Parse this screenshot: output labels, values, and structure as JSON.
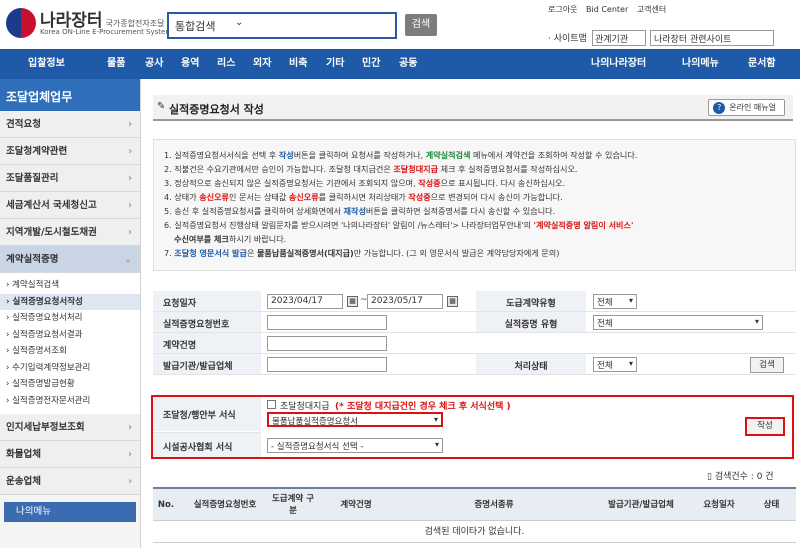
{
  "header": {
    "logo_title": "나라장터",
    "logo_small": "국가종합전자조달",
    "logo_sub": "Korea ON-Line E-Procurement System",
    "search_select": "통합검색",
    "search_button": "검색",
    "top_links": [
      "로그아웃",
      "Bid Center",
      "고객센터"
    ],
    "sitemap_label": "· 사이트맵",
    "sitemap_select": "관계기관",
    "related_select": "나라장터 관련사이트"
  },
  "nav": {
    "items": [
      "입찰정보",
      "물품",
      "공사",
      "용역",
      "리스",
      "외자",
      "비축",
      "기타",
      "민간",
      "공동",
      "나의나라장터",
      "나의메뉴",
      "문서함"
    ]
  },
  "sidebar": {
    "title": "조달업체업무",
    "items": [
      "견적요청",
      "조달청계약관련",
      "조달품질관리",
      "세금계산서 국세청신고",
      "지역개발/도시철도채권",
      "계약실적증명"
    ],
    "subitems": [
      "계약실적검색",
      "실적증명요청서작성",
      "실적증명요청서처리",
      "실적증명요청서결과",
      "실적증명서조회",
      "수기입력계약정보관리",
      "실적증명발급현황",
      "실적증명전자문서관리"
    ],
    "items2": [
      "인지세납부정보조회",
      "화물업체",
      "운송업체"
    ],
    "my_menu": "나의메뉴"
  },
  "page": {
    "title": "실적증명요청서 작성",
    "manual_button": "온라인 매뉴얼"
  },
  "notice": {
    "l1a": "1. 실적증명요청서서식을 선택 후 ",
    "l1b": "작성",
    "l1c": "버튼을 클릭하여 요청서를 작성하거나, ",
    "l1d": "계약실적검색",
    "l1e": " 메뉴에서 계약건을 조회하여 작성할 수 있습니다.",
    "l2a": "2. 직불건은 수요기관에서만 승인이 가능합니다. 조달청 대지급건은 ",
    "l2b": "조달청대지급",
    "l2c": " 체크 후 실적증명요청서를 작성하십시오.",
    "l3a": "3. 정상적으로 송신되지 않은 실적증명요청서는 기관에서 조회되지 않으며, ",
    "l3b": "작성중",
    "l3c": "으로 표시됩니다. 다시 송신하십시오.",
    "l4a": "4. 상태가 ",
    "l4b": "송신오류",
    "l4c": "인 문서는 상태값 ",
    "l4d": "송신오류",
    "l4e": "를 클릭하시면 처리상태가 ",
    "l4f": "작성중",
    "l4g": "으로 변경되어 다시 송신이 가능합니다.",
    "l5a": "5. 송신 후 실적증명요청서를 클릭하여 상세화면에서 ",
    "l5b": "재작성",
    "l5c": "버튼을 클릭하면 실적증명서를 다시 송신할 수 있습니다.",
    "l6a": "6. 실적증명요청서 진행상태 알림문자를 받으시려면 '나의나라장터' 알림이 /뉴스레터'> 나라장터업무안내'의 ",
    "l6b": "'계약실적증명 알림이 서비스'",
    "l6c": "수신여부를 체크",
    "l6d": "하시기 바랍니다.",
    "l7a": "7. ",
    "l7b": "조달청 영문서식 발급",
    "l7c": "은 ",
    "l7d": "물품납품실적증명서(대지급)",
    "l7e": "만 가능합니다. (그 외 영문서식 발급은 계약담당자에게 문의)"
  },
  "form": {
    "request_date_label": "요청일자",
    "date_from": "2023/04/17",
    "date_tilde": "~",
    "date_to": "2023/05/17",
    "contract_type_label": "도급계약유형",
    "contract_type_value": "전체",
    "request_no_label": "실적증명요청번호",
    "proof_type_label": "실적증명 유형",
    "proof_type_value": "전체",
    "contract_name_label": "계약건명",
    "issuer_label": "발급기관/발급업체",
    "status_label": "처리상태",
    "status_value": "전체",
    "search_button": "검색",
    "pps_form_label": "조달청/행안부 서식",
    "pps_checkbox_label": "조달청대지급",
    "pps_note": "(* 조달청 대지급건인 경우 체크 후 서식선택 )",
    "pps_form_value": "물품납품실적증명요청서",
    "write_button": "작성",
    "assoc_form_label": "시설공사협회 서식",
    "assoc_form_value": "- 실적증명요청서식 선택 -"
  },
  "results": {
    "count_label": "검색건수 : 0 건",
    "columns": [
      "No.",
      "실적증명요청번호",
      "도급계약 구분",
      "계약건명",
      "증명서종류",
      "발급기관/발급업체",
      "요청일자",
      "상태"
    ],
    "empty_message": "검색된 데이타가 없습니다."
  },
  "colors": {
    "nav": "#1e5aa8",
    "sidebar_title": "#2f6fba",
    "highlight_red": "#dd1111"
  }
}
